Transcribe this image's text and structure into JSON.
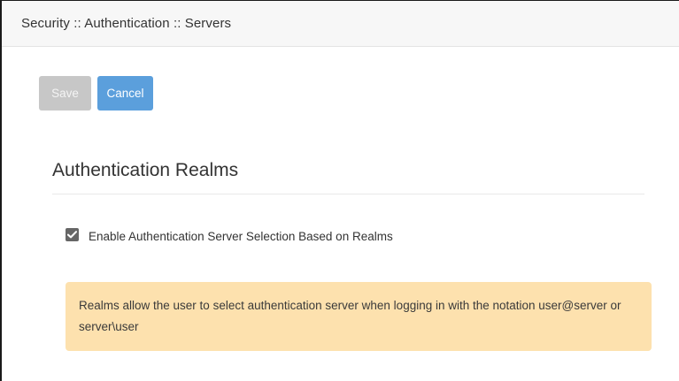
{
  "header": {
    "breadcrumb": "Security :: Authentication :: Servers"
  },
  "toolbar": {
    "save_label": "Save",
    "save_enabled": false,
    "cancel_label": "Cancel"
  },
  "section": {
    "title": "Authentication Realms",
    "checkbox": {
      "label": "Enable Authentication Server Selection Based on Realms",
      "checked": true
    },
    "info_alert": {
      "text": "Realms allow the user to select authentication server when logging in with the notation user@server or server\\user"
    }
  },
  "colors": {
    "header_bg": "#f7f7f7",
    "save_disabled_bg": "#c7c7c7",
    "cancel_bg": "#5b9fdc",
    "checkbox_bg": "#666666",
    "alert_bg": "#fde1ae",
    "text": "#333333"
  },
  "icons": {
    "checkbox_mark": "checkmark-icon"
  }
}
